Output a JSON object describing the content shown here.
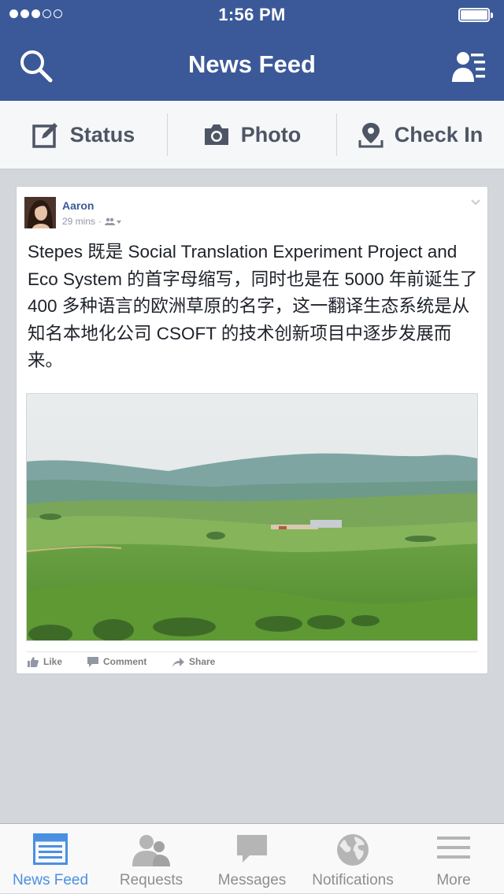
{
  "status_bar": {
    "time": "1:56 PM",
    "signal_filled": 3,
    "signal_total": 5
  },
  "header": {
    "title": "News Feed",
    "search_icon": "search-icon",
    "friends_icon": "friend-requests-icon"
  },
  "action_bar": {
    "status_label": "Status",
    "photo_label": "Photo",
    "checkin_label": "Check In"
  },
  "post": {
    "author": "Aaron",
    "time": "29 mins",
    "separator": "·",
    "audience_icon": "friends-audience-icon",
    "text": "Stepes 既是 Social Translation Experiment Project and Eco System 的首字母缩写，同时也是在 5000 年前诞生了 400 多种语言的欧洲草原的名字，这一翻译生态系统是从知名本地化公司 CSOFT 的技术创新项目中逐步发展而来。",
    "photo_alt": "green rolling hills landscape",
    "actions": {
      "like": "Like",
      "comment": "Comment",
      "share": "Share"
    }
  },
  "tab_bar": {
    "active": "news_feed",
    "tabs": [
      {
        "id": "news_feed",
        "label": "News Feed",
        "icon": "news-feed-icon"
      },
      {
        "id": "requests",
        "label": "Requests",
        "icon": "requests-icon"
      },
      {
        "id": "messages",
        "label": "Messages",
        "icon": "messages-icon"
      },
      {
        "id": "notifications",
        "label": "Notifications",
        "icon": "globe-icon"
      },
      {
        "id": "more",
        "label": "More",
        "icon": "menu-icon"
      }
    ]
  },
  "colors": {
    "brand": "#3b5998",
    "tab_active": "#4a90e2",
    "tab_inactive": "#8e8e93",
    "background": "#d3d6db"
  }
}
